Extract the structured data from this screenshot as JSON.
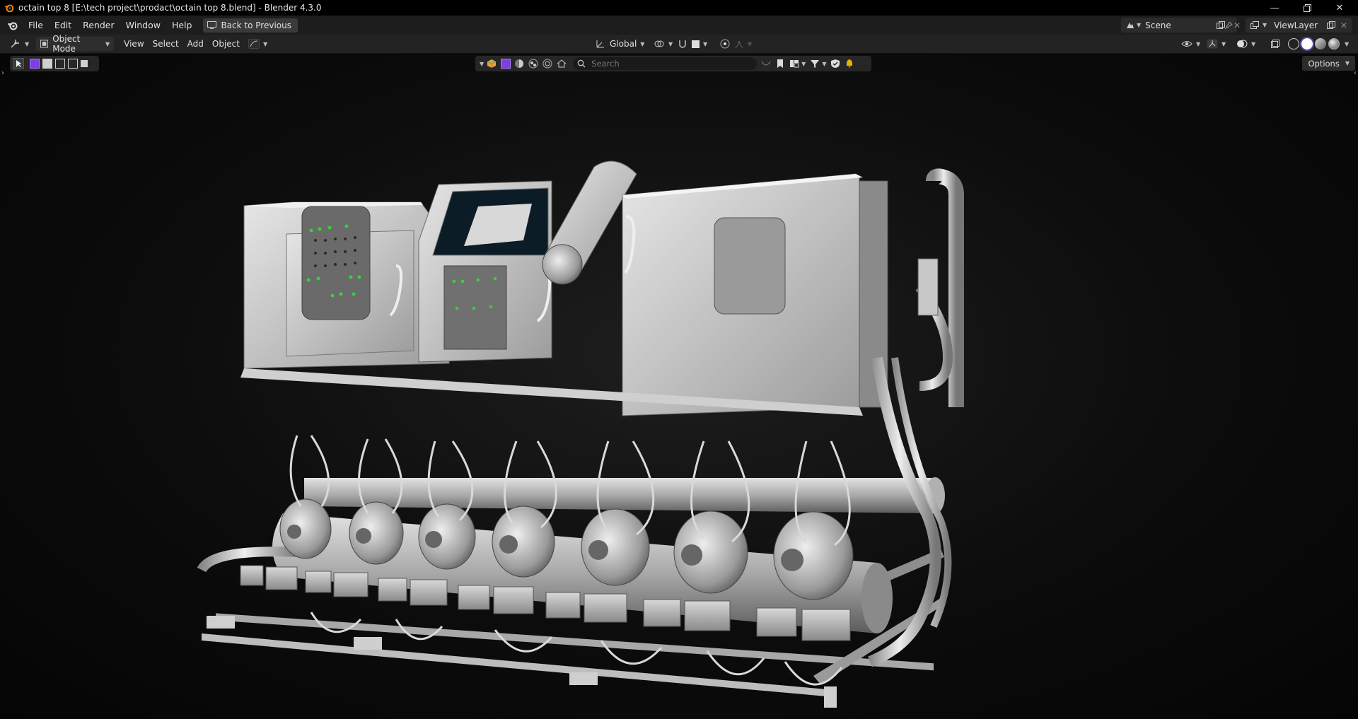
{
  "window": {
    "title": "octain top 8 [E:\\tech project\\prodact\\octain top 8.blend] - Blender 4.3.0",
    "controls": [
      "minimize",
      "restore",
      "close"
    ]
  },
  "menubar": {
    "items": [
      "File",
      "Edit",
      "Render",
      "Window",
      "Help"
    ],
    "back_label": "Back to Previous",
    "scene_label": "Scene",
    "view_layer_label": "ViewLayer"
  },
  "header": {
    "mode_label": "Object Mode",
    "menus": [
      "View",
      "Select",
      "Add",
      "Object"
    ],
    "orientation_label": "Global"
  },
  "viewport": {
    "search_placeholder": "Search",
    "options_label": "Options",
    "accent_color": "#7b3fe4",
    "model_description": "industrial refrigeration compressor rack (solid shading)"
  }
}
